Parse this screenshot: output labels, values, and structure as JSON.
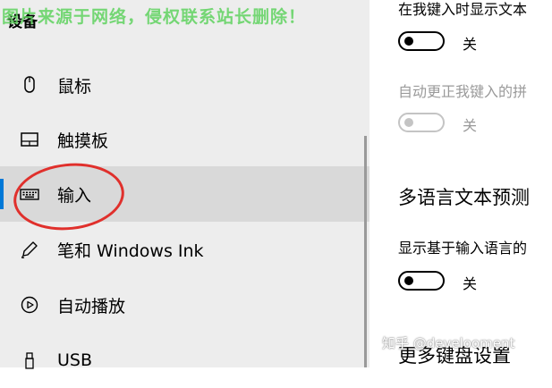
{
  "watermark_top": "图片来源于网络，侵权联系站长删除！",
  "sidebar": {
    "title": "设备",
    "items": [
      {
        "label": "鼠标",
        "icon": "mouse-icon"
      },
      {
        "label": "触摸板",
        "icon": "touchpad-icon"
      },
      {
        "label": "输入",
        "icon": "keyboard-icon",
        "selected": true
      },
      {
        "label": "笔和 Windows Ink",
        "icon": "pen-icon"
      },
      {
        "label": "自动播放",
        "icon": "autoplay-icon"
      },
      {
        "label": "USB",
        "icon": "usb-icon"
      }
    ]
  },
  "main": {
    "setting1": {
      "label": "在我键入时显示文本",
      "toggle_state": "关",
      "on": false
    },
    "setting2": {
      "label": "自动更正我键入的拼",
      "toggle_state": "关",
      "on": false,
      "disabled": true
    },
    "section_heading": "多语言文本预测",
    "setting3": {
      "label": "显示基于输入语言的",
      "toggle_state": "关",
      "on": false
    },
    "section_heading2": "更多键盘设置"
  },
  "watermark_bottom": "知乎 @develooment",
  "colors": {
    "accent": "#0078d7",
    "annotation": "#e0302c",
    "sidebar_bg": "#ededed",
    "selected_bg": "#d9d9d9"
  }
}
